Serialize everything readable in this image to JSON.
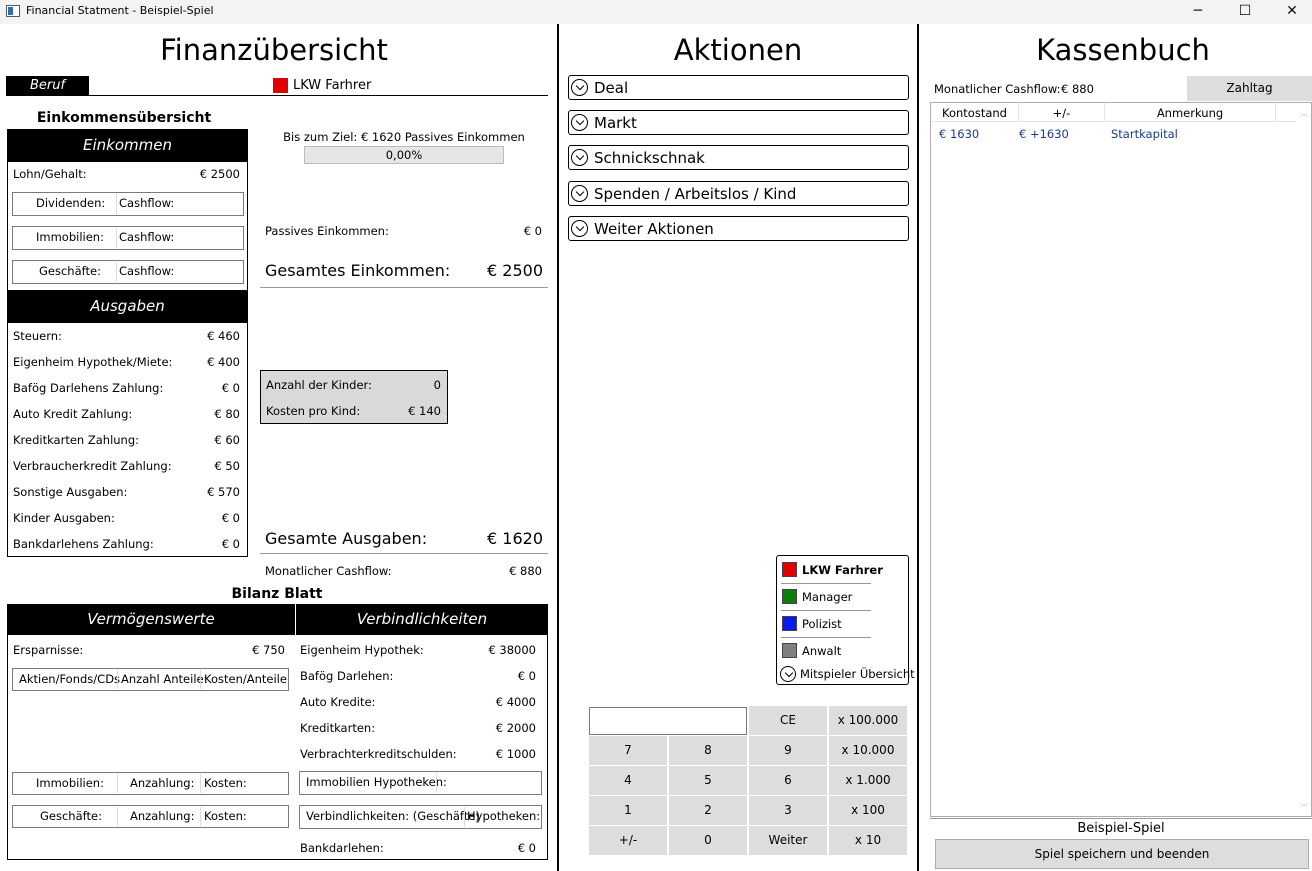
{
  "window": {
    "title": "Financial Statment - Beispiel-Spiel"
  },
  "colors": {
    "lkw": "#e00000",
    "manager": "#0b7d0b",
    "polizist": "#0a1aef",
    "anwalt": "#7f7f7f"
  },
  "left": {
    "heading": "Finanzübersicht",
    "beruf_label": "Beruf",
    "beruf_value": "LKW Farhrer",
    "income_overview": "Einkommensübersicht",
    "einkommen_head": "Einkommen",
    "lohn_label": "Lohn/Gehalt:",
    "lohn_value": "€ 2500",
    "income_buttons": [
      {
        "label": "Dividenden:",
        "cashflow": "Cashflow:"
      },
      {
        "label": "Immobilien:",
        "cashflow": "Cashflow:"
      },
      {
        "label": "Geschäfte:",
        "cashflow": "Cashflow:"
      }
    ],
    "ausgaben_head": "Ausgaben",
    "expenses": [
      {
        "label": "Steuern:",
        "value": "€ 460"
      },
      {
        "label": "Eigenheim Hypothek/Miete:",
        "value": "€ 400"
      },
      {
        "label": "Bafög Darlehens Zahlung:",
        "value": "€ 0"
      },
      {
        "label": "Auto Kredit Zahlung:",
        "value": "€ 80"
      },
      {
        "label": "Kreditkarten Zahlung:",
        "value": "€ 60"
      },
      {
        "label": "Verbraucherkredit Zahlung:",
        "value": "€ 50"
      },
      {
        "label": "Sonstige Ausgaben:",
        "value": "€ 570"
      },
      {
        "label": "Kinder Ausgaben:",
        "value": "€ 0"
      },
      {
        "label": "Bankdarlehens Zahlung:",
        "value": "€ 0"
      }
    ],
    "goal_text": "Bis zum Ziel: € 1620 Passives Einkommen",
    "goal_progress_text": "0,00%",
    "goal_progress": 0,
    "passive_label": "Passives Einkommen:",
    "passive_value": "€ 0",
    "total_income_label": "Gesamtes Einkommen:",
    "total_income_value": "€ 2500",
    "kids_label": "Anzahl der Kinder:",
    "kids_value": "0",
    "kid_cost_label": "Kosten pro Kind:",
    "kid_cost_value": "€ 140",
    "total_exp_label": "Gesamte Ausgaben:",
    "total_exp_value": "€ 1620",
    "monthly_cf_label": "Monatlicher Cashflow:",
    "monthly_cf_value": "€ 880",
    "bilanz_head": "Bilanz Blatt",
    "assets_head": "Vermögenswerte",
    "liab_head": "Verbindlichkeiten",
    "ersparnisse_label": "Ersparnisse:",
    "ersparnisse_value": "€ 750",
    "stocks_btn": [
      "Aktien/Fonds/CDs",
      "Anzahl Anteile:",
      "Kosten/Anteile"
    ],
    "realestate_btn": [
      "Immobilien:",
      "Anzahlung:",
      "Kosten:"
    ],
    "business_btn": [
      "Geschäfte:",
      "Anzahlung:",
      "Kosten:"
    ],
    "liabilities": [
      {
        "label": "Eigenheim Hypothek:",
        "value": "€ 38000"
      },
      {
        "label": "Bafög Darlehen:",
        "value": "€ 0"
      },
      {
        "label": "Auto Kredite:",
        "value": "€ 4000"
      },
      {
        "label": "Kreditkarten:",
        "value": "€ 2000"
      },
      {
        "label": "Verbrachterkreditschulden:",
        "value": "€ 1000"
      }
    ],
    "mortgage_btn": "Immobilien Hypotheken:",
    "liab_business_btn": [
      "Verbindlichkeiten: (Geschäfte)",
      "Hypotheken:"
    ],
    "bank_label": "Bankdarlehen:",
    "bank_value": "€ 0"
  },
  "middle": {
    "heading": "Aktionen",
    "actions": [
      "Deal",
      "Markt",
      "Schnickschnak",
      "Spenden / Arbeitslos / Kind",
      "Weiter Aktionen"
    ],
    "players": [
      "LKW Farhrer",
      "Manager",
      "Polizist",
      "Anwalt"
    ],
    "players_overview": "Mitspieler Übersicht",
    "keypad": {
      "display": "",
      "ce": "CE",
      "rows": [
        [
          "7",
          "8",
          "9"
        ],
        [
          "4",
          "5",
          "6"
        ],
        [
          "1",
          "2",
          "3"
        ],
        [
          "+/-",
          "0",
          "Weiter"
        ]
      ],
      "multipliers": [
        "x 100.000",
        "x 10.000",
        "x 1.000",
        "x 100",
        "x 10"
      ]
    }
  },
  "right": {
    "heading": "Kassenbuch",
    "cashflow_label": "Monatlicher Cashflow:",
    "cashflow_value": "€ 880",
    "zahltag": "Zahltag",
    "columns": [
      "Kontostand",
      "+/-",
      "Anmerkung"
    ],
    "rows": [
      {
        "kontostand": "€ 1630",
        "delta": "€ +1630",
        "note": "Startkapital"
      }
    ],
    "game_name": "Beispiel-Spiel",
    "save_button": "Spiel speichern und beenden"
  }
}
